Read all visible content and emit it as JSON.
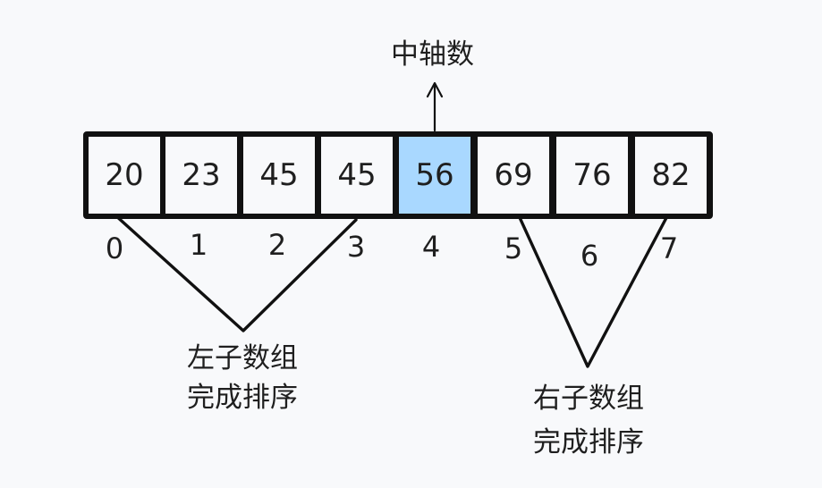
{
  "pivot_label": "中轴数",
  "cells": [
    {
      "value": "20",
      "index": "0",
      "is_pivot": false
    },
    {
      "value": "23",
      "index": "1",
      "is_pivot": false
    },
    {
      "value": "45",
      "index": "2",
      "is_pivot": false
    },
    {
      "value": "45",
      "index": "3",
      "is_pivot": false
    },
    {
      "value": "56",
      "index": "4",
      "is_pivot": true
    },
    {
      "value": "69",
      "index": "5",
      "is_pivot": false
    },
    {
      "value": "76",
      "index": "6",
      "is_pivot": false
    },
    {
      "value": "82",
      "index": "7",
      "is_pivot": false
    }
  ],
  "left_group": {
    "line1": "左子数组",
    "line2": "完成排序"
  },
  "right_group": {
    "line1": "右子数组",
    "line2": "完成排序"
  },
  "colors": {
    "pivot_fill": "#a9d8ff",
    "stroke": "#111111",
    "background": "#f8f9fb"
  }
}
